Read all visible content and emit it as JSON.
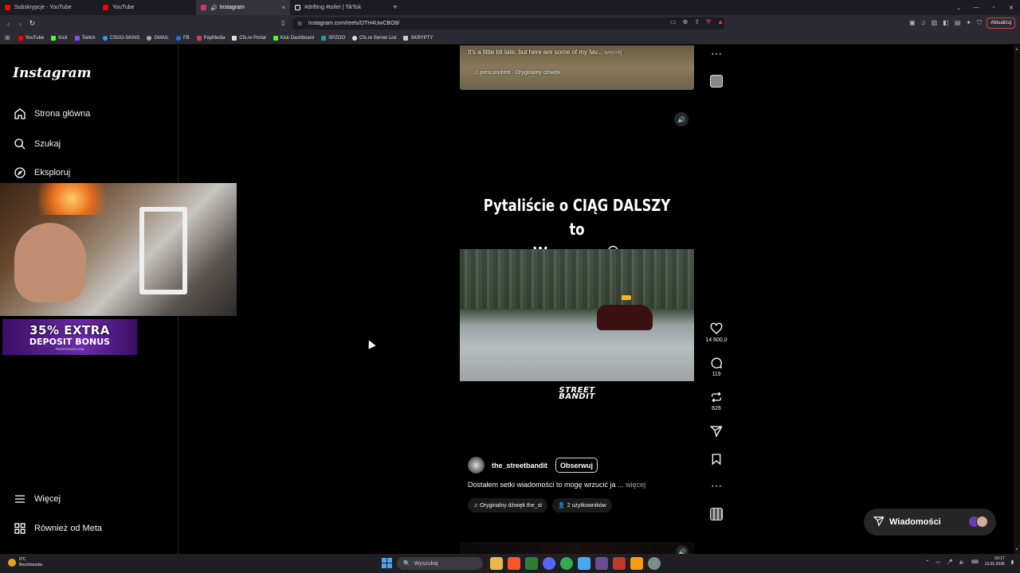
{
  "browser": {
    "tabs": [
      {
        "title": "Subskrypcje - YouTube",
        "color": "#ff0000"
      },
      {
        "title": "YouTube",
        "color": "#ff0000"
      },
      {
        "title": "Instagram",
        "color": "#e1306c",
        "active": true
      },
      {
        "title": "#drifting #toilet | TikTok",
        "color": "#ffffff"
      }
    ],
    "tab_close": "×",
    "new_tab": "+",
    "url": "instagram.com/reels/DTH4UwCBO8/",
    "update_button": "Aktualizuj",
    "bookmarks": [
      {
        "label": "YouTube",
        "color": "#ff0000"
      },
      {
        "label": "Kick",
        "color": "#53fc18"
      },
      {
        "label": "Twitch",
        "color": "#9146ff"
      },
      {
        "label": "CSGO-SKINS",
        "color": "#3399ff"
      },
      {
        "label": "GMAIL",
        "color": "#aaaaaa"
      },
      {
        "label": "FB",
        "color": "#1877f2"
      },
      {
        "label": "PayMedia",
        "color": "#e63946"
      },
      {
        "label": "Cfx.re Portal",
        "color": "#dddddd"
      },
      {
        "label": "Kick Dashboard",
        "color": "#53fc18"
      },
      {
        "label": "SPZOO",
        "color": "#2a9d8f"
      },
      {
        "label": "Cfx.re Server List",
        "color": "#dddddd"
      },
      {
        "label": "SKRYPTY",
        "color": "#cccccc"
      }
    ]
  },
  "instagram": {
    "logo": "Instagram",
    "nav": [
      {
        "label": "Strona główna",
        "icon": "home-icon"
      },
      {
        "label": "Szukaj",
        "icon": "search-icon"
      },
      {
        "label": "Eksploruj",
        "icon": "compass-icon"
      }
    ],
    "nav_bottom": [
      {
        "label": "Więcej",
        "icon": "menu-icon"
      },
      {
        "label": "Również od Meta",
        "icon": "meta-grid-icon"
      }
    ],
    "prev_reel": {
      "caption": "It's a little bit late, but here are some of my fav...",
      "more": "więcej",
      "audio": "joescandrett · Oryginalny dźwięk"
    },
    "reel": {
      "headline_line1": "Pytaliście o CIĄG DALSZY to",
      "headline_line2": "Wrzucam 😂",
      "brand_line1": "STREET",
      "brand_line2": "BANDIT",
      "author": "the_streetbandit",
      "follow": "Obserwuj",
      "caption": "Dostałem setki wiadomości to mogę wrzucić ja ...",
      "more": "więcej",
      "audio": "Oryginalny dźwięk  the_st",
      "users": "2 użytkowników"
    },
    "actions": {
      "likes": "14 600,0",
      "comments": "119",
      "reposts": "626"
    },
    "messages_label": "Wiadomości"
  },
  "overlay": {
    "ad_line1": "35% EXTRA",
    "ad_line2": "DEPOSIT BONUS",
    "ad_line3": "PIRATESWAP.COM"
  },
  "taskbar": {
    "weather_temp": "0°C",
    "weather_desc": "Bezchmurnie",
    "search_placeholder": "Wyszukaj",
    "time": "03:17",
    "date": "13.01.2026"
  }
}
